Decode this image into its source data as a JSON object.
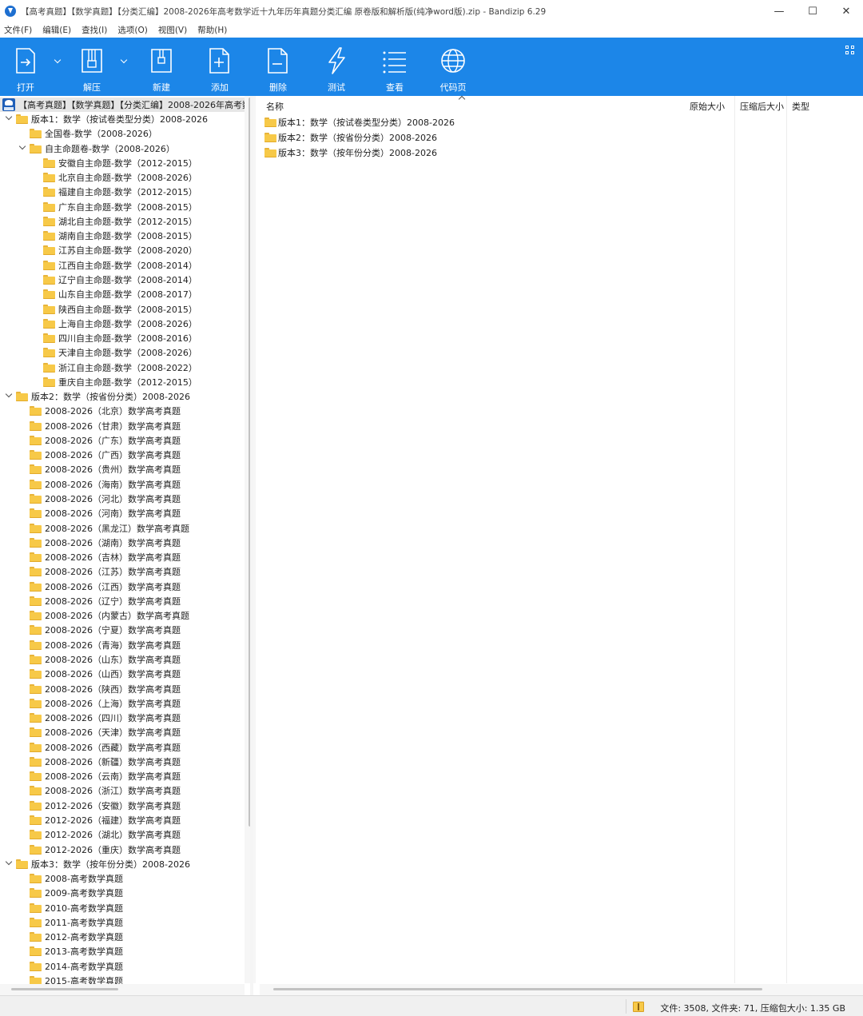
{
  "window": {
    "title": "【高考真题】【数学真题】【分类汇编】2008-2026年高考数学近十九年历年真题分类汇编  原卷版和解析版(纯净word版).zip - Bandizip 6.29",
    "minimize": "—",
    "maximize": "☐",
    "close": "✕"
  },
  "menu": [
    "文件(F)",
    "编辑(E)",
    "查找(I)",
    "选项(O)",
    "视图(V)",
    "帮助(H)"
  ],
  "toolbar": {
    "open": "打开",
    "extract": "解压",
    "new": "新建",
    "add": "添加",
    "delete": "删除",
    "test": "测试",
    "view": "查看",
    "codepage": "代码页"
  },
  "tree": {
    "root": "【高考真题】【数学真题】【分类汇编】2008-2026年高考数学",
    "items": [
      "版本1：数学（按试卷类型分类）2008-2026",
      "全国卷-数学（2008-2026）",
      "自主命题卷-数学（2008-2026）",
      "安徽自主命题-数学（2012-2015）",
      "北京自主命题-数学（2008-2026）",
      "福建自主命题-数学（2012-2015）",
      "广东自主命题-数学（2008-2015）",
      "湖北自主命题-数学（2012-2015）",
      "湖南自主命题-数学（2008-2015）",
      "江苏自主命题-数学（2008-2020）",
      "江西自主命题-数学（2008-2014）",
      "辽宁自主命题-数学（2008-2014）",
      "山东自主命题-数学（2008-2017）",
      "陕西自主命题-数学（2008-2015）",
      "上海自主命题-数学（2008-2026）",
      "四川自主命题-数学（2008-2016）",
      "天津自主命题-数学（2008-2026）",
      "浙江自主命题-数学（2008-2022）",
      "重庆自主命题-数学（2012-2015）",
      "版本2：数学（按省份分类）2008-2026",
      "2008-2026（北京）数学高考真题",
      "2008-2026（甘肃）数学高考真题",
      "2008-2026（广东）数学高考真题",
      "2008-2026（广西）数学高考真题",
      "2008-2026（贵州）数学高考真题",
      "2008-2026（海南）数学高考真题",
      "2008-2026（河北）数学高考真题",
      "2008-2026（河南）数学高考真题",
      "2008-2026（黑龙江）数学高考真题",
      "2008-2026（湖南）数学高考真题",
      "2008-2026（吉林）数学高考真题",
      "2008-2026（江苏）数学高考真题",
      "2008-2026（江西）数学高考真题",
      "2008-2026（辽宁）数学高考真题",
      "2008-2026（内蒙古）数学高考真题",
      "2008-2026（宁夏）数学高考真题",
      "2008-2026（青海）数学高考真题",
      "2008-2026（山东）数学高考真题",
      "2008-2026（山西）数学高考真题",
      "2008-2026（陕西）数学高考真题",
      "2008-2026（上海）数学高考真题",
      "2008-2026（四川）数学高考真题",
      "2008-2026（天津）数学高考真题",
      "2008-2026（西藏）数学高考真题",
      "2008-2026（新疆）数学高考真题",
      "2008-2026（云南）数学高考真题",
      "2008-2026（浙江）数学高考真题",
      "2012-2026（安徽）数学高考真题",
      "2012-2026（福建）数学高考真题",
      "2012-2026（湖北）数学高考真题",
      "2012-2026（重庆）数学高考真题",
      "版本3：数学（按年份分类）2008-2026",
      "2008-高考数学真题",
      "2009-高考数学真题",
      "2010-高考数学真题",
      "2011-高考数学真题",
      "2012-高考数学真题",
      "2013-高考数学真题",
      "2014-高考数学真题",
      "2015-高考数学真题"
    ]
  },
  "list": {
    "columns": {
      "name": "名称",
      "size": "原始大小",
      "packed": "压缩后大小",
      "type": "类型"
    },
    "rows": [
      "版本1：数学（按试卷类型分类）2008-2026",
      "版本2：数学（按省份分类）2008-2026",
      "版本3：数学（按年份分类）2008-2026"
    ]
  },
  "status": {
    "text": "文件: 3508, 文件夹: 71, 压缩包大小: 1.35 GB"
  }
}
